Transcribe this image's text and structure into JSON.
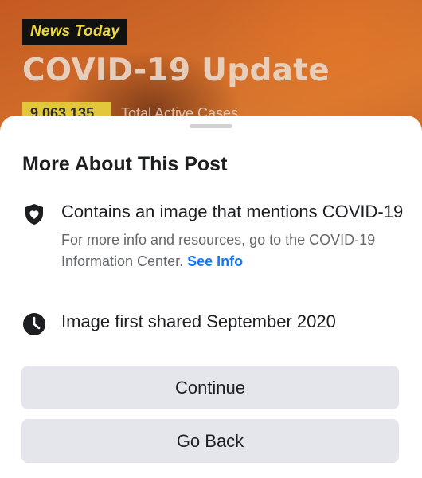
{
  "background_post": {
    "badge_news": "News",
    "badge_today": "Today",
    "headline": "COVID-19 Update",
    "count": "9,063,135",
    "count_label": "Total Active Cases"
  },
  "sheet": {
    "title": "More About This Post",
    "rows": [
      {
        "icon": "shield-heart-icon",
        "main": "Contains an image that mentions COVID-19",
        "sub_prefix": "For more info and resources, go to the COVID-19 Information Center.",
        "link_label": "See Info"
      },
      {
        "icon": "clock-icon",
        "main": "Image first shared September 2020"
      }
    ],
    "buttons": {
      "continue": "Continue",
      "go_back": "Go Back"
    }
  },
  "colors": {
    "link": "#1877f2",
    "button_bg": "#e4e6eb",
    "badge_text": "#f2d93a"
  }
}
